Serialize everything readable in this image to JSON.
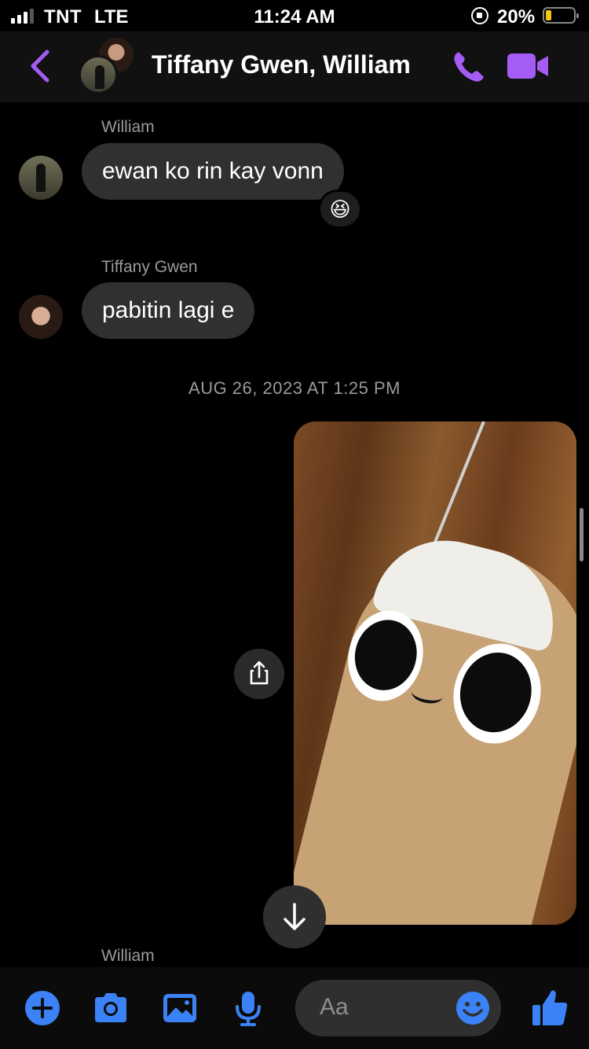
{
  "status_bar": {
    "carrier": "TNT",
    "network": "LTE",
    "time": "11:24 AM",
    "battery_percent": "20%",
    "battery_level": 0.2,
    "signal_bars": 3,
    "signal_max": 4
  },
  "header": {
    "back_icon": "chevron-left-icon",
    "title": "Tiffany Gwen, William",
    "call_icon": "phone-icon",
    "video_icon": "video-camera-icon",
    "accent_color": "#a45cf5"
  },
  "messages": [
    {
      "sender": "William",
      "text": "ewan ko rin kay vonn",
      "reaction": "😆"
    },
    {
      "sender": "Tiffany Gwen",
      "text": "pabitin lagi e"
    }
  ],
  "timestamp": "AUG 26, 2023 AT 1:25 PM",
  "photo": {
    "icon": "share-icon"
  },
  "next_sender": "William",
  "scroll_down_icon": "arrow-down-icon",
  "composer": {
    "placeholder": "Aa",
    "tools": [
      "plus-icon",
      "camera-icon",
      "image-icon",
      "microphone-icon"
    ],
    "emoji_icon": "smiley-icon",
    "like_icon": "thumbs-up-icon",
    "tool_color": "#3b82f6"
  }
}
